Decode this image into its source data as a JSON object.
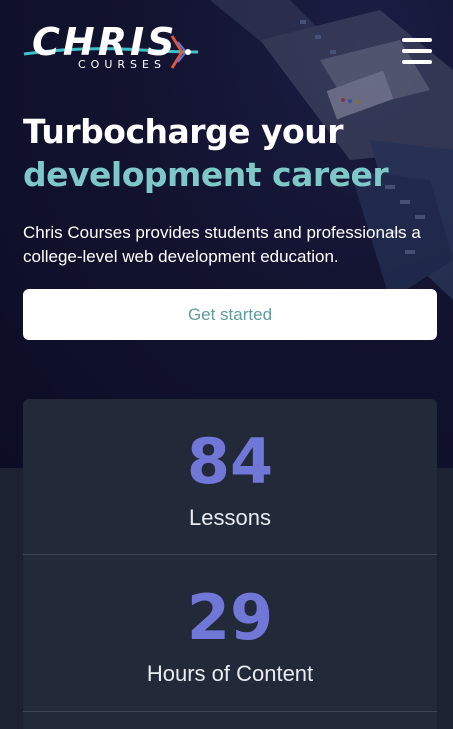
{
  "brand": {
    "logo_main": "CHRIS",
    "logo_sub": "COURSES"
  },
  "header": {
    "menu_icon": "hamburger-menu-icon"
  },
  "hero": {
    "title_line1": "Turbocharge your",
    "title_line2": "development career",
    "description": "Chris Courses provides students and professionals a college-level web development education.",
    "cta_label": "Get started"
  },
  "stats": [
    {
      "value": "84",
      "label": "Lessons"
    },
    {
      "value": "29",
      "label": "Hours of Content"
    }
  ],
  "colors": {
    "accent_teal": "#7fc8c8",
    "stat_purple": "#7177d6",
    "hero_bg": "#0e0f2a",
    "card_bg": "#222938"
  }
}
